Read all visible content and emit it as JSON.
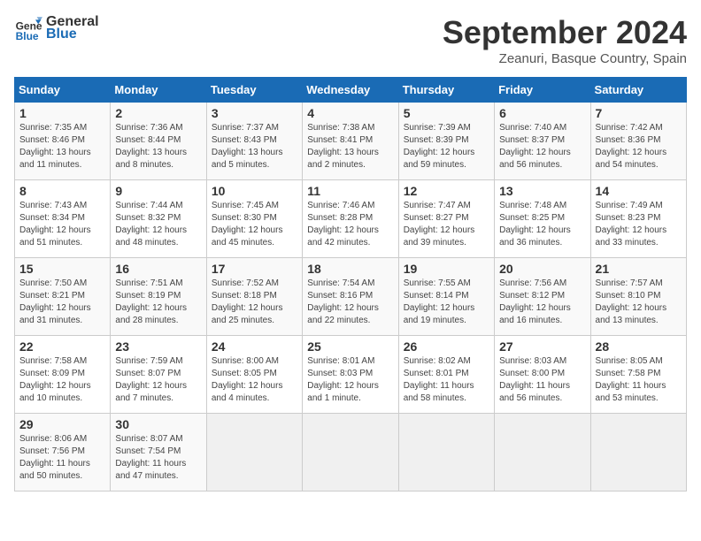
{
  "header": {
    "logo_line1": "General",
    "logo_line2": "Blue",
    "month": "September 2024",
    "location": "Zeanuri, Basque Country, Spain"
  },
  "weekdays": [
    "Sunday",
    "Monday",
    "Tuesday",
    "Wednesday",
    "Thursday",
    "Friday",
    "Saturday"
  ],
  "weeks": [
    [
      {
        "day": "1",
        "content": "Sunrise: 7:35 AM\nSunset: 8:46 PM\nDaylight: 13 hours\nand 11 minutes."
      },
      {
        "day": "2",
        "content": "Sunrise: 7:36 AM\nSunset: 8:44 PM\nDaylight: 13 hours\nand 8 minutes."
      },
      {
        "day": "3",
        "content": "Sunrise: 7:37 AM\nSunset: 8:43 PM\nDaylight: 13 hours\nand 5 minutes."
      },
      {
        "day": "4",
        "content": "Sunrise: 7:38 AM\nSunset: 8:41 PM\nDaylight: 13 hours\nand 2 minutes."
      },
      {
        "day": "5",
        "content": "Sunrise: 7:39 AM\nSunset: 8:39 PM\nDaylight: 12 hours\nand 59 minutes."
      },
      {
        "day": "6",
        "content": "Sunrise: 7:40 AM\nSunset: 8:37 PM\nDaylight: 12 hours\nand 56 minutes."
      },
      {
        "day": "7",
        "content": "Sunrise: 7:42 AM\nSunset: 8:36 PM\nDaylight: 12 hours\nand 54 minutes."
      }
    ],
    [
      {
        "day": "8",
        "content": "Sunrise: 7:43 AM\nSunset: 8:34 PM\nDaylight: 12 hours\nand 51 minutes."
      },
      {
        "day": "9",
        "content": "Sunrise: 7:44 AM\nSunset: 8:32 PM\nDaylight: 12 hours\nand 48 minutes."
      },
      {
        "day": "10",
        "content": "Sunrise: 7:45 AM\nSunset: 8:30 PM\nDaylight: 12 hours\nand 45 minutes."
      },
      {
        "day": "11",
        "content": "Sunrise: 7:46 AM\nSunset: 8:28 PM\nDaylight: 12 hours\nand 42 minutes."
      },
      {
        "day": "12",
        "content": "Sunrise: 7:47 AM\nSunset: 8:27 PM\nDaylight: 12 hours\nand 39 minutes."
      },
      {
        "day": "13",
        "content": "Sunrise: 7:48 AM\nSunset: 8:25 PM\nDaylight: 12 hours\nand 36 minutes."
      },
      {
        "day": "14",
        "content": "Sunrise: 7:49 AM\nSunset: 8:23 PM\nDaylight: 12 hours\nand 33 minutes."
      }
    ],
    [
      {
        "day": "15",
        "content": "Sunrise: 7:50 AM\nSunset: 8:21 PM\nDaylight: 12 hours\nand 31 minutes."
      },
      {
        "day": "16",
        "content": "Sunrise: 7:51 AM\nSunset: 8:19 PM\nDaylight: 12 hours\nand 28 minutes."
      },
      {
        "day": "17",
        "content": "Sunrise: 7:52 AM\nSunset: 8:18 PM\nDaylight: 12 hours\nand 25 minutes."
      },
      {
        "day": "18",
        "content": "Sunrise: 7:54 AM\nSunset: 8:16 PM\nDaylight: 12 hours\nand 22 minutes."
      },
      {
        "day": "19",
        "content": "Sunrise: 7:55 AM\nSunset: 8:14 PM\nDaylight: 12 hours\nand 19 minutes."
      },
      {
        "day": "20",
        "content": "Sunrise: 7:56 AM\nSunset: 8:12 PM\nDaylight: 12 hours\nand 16 minutes."
      },
      {
        "day": "21",
        "content": "Sunrise: 7:57 AM\nSunset: 8:10 PM\nDaylight: 12 hours\nand 13 minutes."
      }
    ],
    [
      {
        "day": "22",
        "content": "Sunrise: 7:58 AM\nSunset: 8:09 PM\nDaylight: 12 hours\nand 10 minutes."
      },
      {
        "day": "23",
        "content": "Sunrise: 7:59 AM\nSunset: 8:07 PM\nDaylight: 12 hours\nand 7 minutes."
      },
      {
        "day": "24",
        "content": "Sunrise: 8:00 AM\nSunset: 8:05 PM\nDaylight: 12 hours\nand 4 minutes."
      },
      {
        "day": "25",
        "content": "Sunrise: 8:01 AM\nSunset: 8:03 PM\nDaylight: 12 hours\nand 1 minute."
      },
      {
        "day": "26",
        "content": "Sunrise: 8:02 AM\nSunset: 8:01 PM\nDaylight: 11 hours\nand 58 minutes."
      },
      {
        "day": "27",
        "content": "Sunrise: 8:03 AM\nSunset: 8:00 PM\nDaylight: 11 hours\nand 56 minutes."
      },
      {
        "day": "28",
        "content": "Sunrise: 8:05 AM\nSunset: 7:58 PM\nDaylight: 11 hours\nand 53 minutes."
      }
    ],
    [
      {
        "day": "29",
        "content": "Sunrise: 8:06 AM\nSunset: 7:56 PM\nDaylight: 11 hours\nand 50 minutes."
      },
      {
        "day": "30",
        "content": "Sunrise: 8:07 AM\nSunset: 7:54 PM\nDaylight: 11 hours\nand 47 minutes."
      },
      {
        "day": "",
        "content": ""
      },
      {
        "day": "",
        "content": ""
      },
      {
        "day": "",
        "content": ""
      },
      {
        "day": "",
        "content": ""
      },
      {
        "day": "",
        "content": ""
      }
    ]
  ]
}
